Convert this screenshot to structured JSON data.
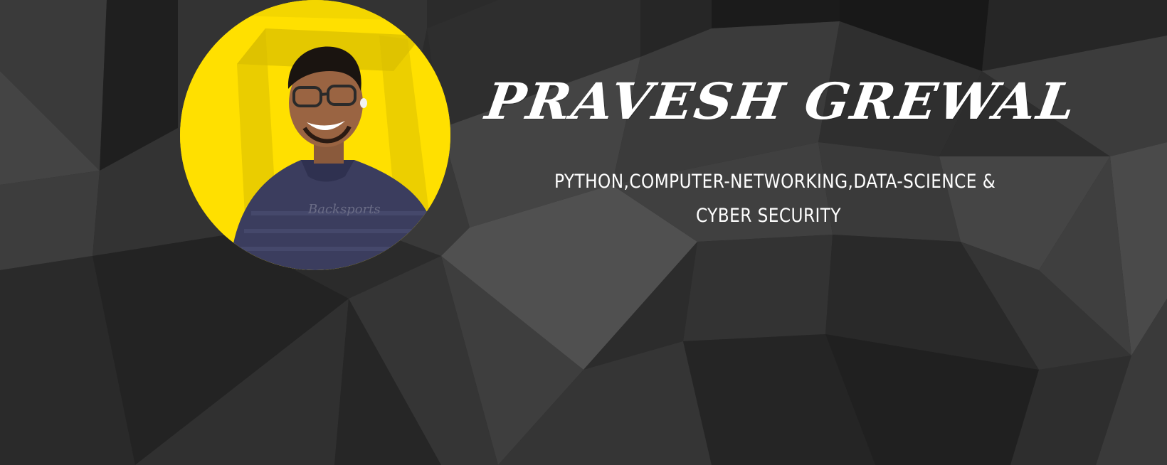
{
  "profile": {
    "name": "PRAVESH GREWAL",
    "tagline_line1": "PYTHON,COMPUTER-NETWORKING,DATA-SCIENCE &",
    "tagline_line2": "CYBER SECURITY",
    "photo": "profile-photo",
    "shirt_text": "Backsports"
  },
  "colors": {
    "background": "#2a2a2a",
    "avatar_bg": "#ffe000",
    "text": "#ffffff",
    "shirt": "#3b3d5e"
  }
}
